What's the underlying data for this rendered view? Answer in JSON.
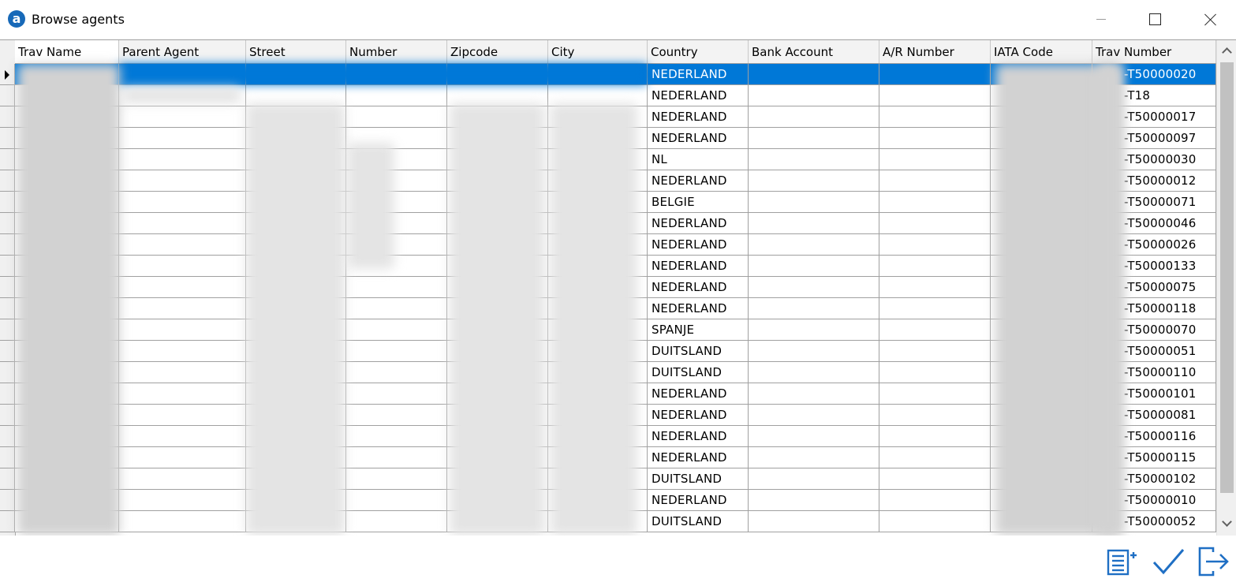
{
  "window": {
    "title": "Browse agents",
    "logo_letter": "a"
  },
  "grid": {
    "columns": [
      {
        "label": "Trav Name"
      },
      {
        "label": "Parent Agent"
      },
      {
        "label": "Street"
      },
      {
        "label": "Number"
      },
      {
        "label": "Zipcode"
      },
      {
        "label": "City"
      },
      {
        "label": "Country"
      },
      {
        "label": "Bank Account"
      },
      {
        "label": "A/R Number"
      },
      {
        "label": "IATA Code"
      },
      {
        "label": "Trav Number"
      }
    ],
    "selected_row": 0,
    "rows": [
      {
        "country": "NEDERLAND",
        "trav_number": "-T50000020"
      },
      {
        "country": "NEDERLAND",
        "trav_number": "-T18"
      },
      {
        "country": "NEDERLAND",
        "trav_number": "-T50000017"
      },
      {
        "country": "NEDERLAND",
        "trav_number": "-T50000097"
      },
      {
        "country": "NL",
        "trav_number": "-T50000030"
      },
      {
        "country": "NEDERLAND",
        "trav_number": "-T50000012"
      },
      {
        "country": "BELGIE",
        "trav_number": "-T50000071"
      },
      {
        "country": "NEDERLAND",
        "trav_number": "-T50000046"
      },
      {
        "country": "NEDERLAND",
        "trav_number": "-T50000026"
      },
      {
        "country": "NEDERLAND",
        "trav_number": "-T50000133"
      },
      {
        "country": "NEDERLAND",
        "trav_number": "-T50000075"
      },
      {
        "country": "NEDERLAND",
        "trav_number": "-T50000118"
      },
      {
        "country": "SPANJE",
        "trav_number": "-T50000070"
      },
      {
        "country": "DUITSLAND",
        "trav_number": "-T50000051"
      },
      {
        "country": "DUITSLAND",
        "trav_number": "-T50000110"
      },
      {
        "country": "NEDERLAND",
        "trav_number": "-T50000101"
      },
      {
        "country": "NEDERLAND",
        "trav_number": "-T50000081"
      },
      {
        "country": "NEDERLAND",
        "trav_number": "-T50000116"
      },
      {
        "country": "NEDERLAND",
        "trav_number": "-T50000115"
      },
      {
        "country": "DUITSLAND",
        "trav_number": "-T50000102"
      },
      {
        "country": "NEDERLAND",
        "trav_number": "-T50000010"
      },
      {
        "country": "DUITSLAND",
        "trav_number": "-T50000052"
      }
    ]
  },
  "footer": {
    "buttons": [
      {
        "icon": "add-record-icon"
      },
      {
        "icon": "checkmark-icon"
      },
      {
        "icon": "exit-icon"
      }
    ]
  },
  "colors": {
    "selection": "#0078d7",
    "icon_blue": "#1f6fc4",
    "logo_blue": "#1769b8"
  }
}
